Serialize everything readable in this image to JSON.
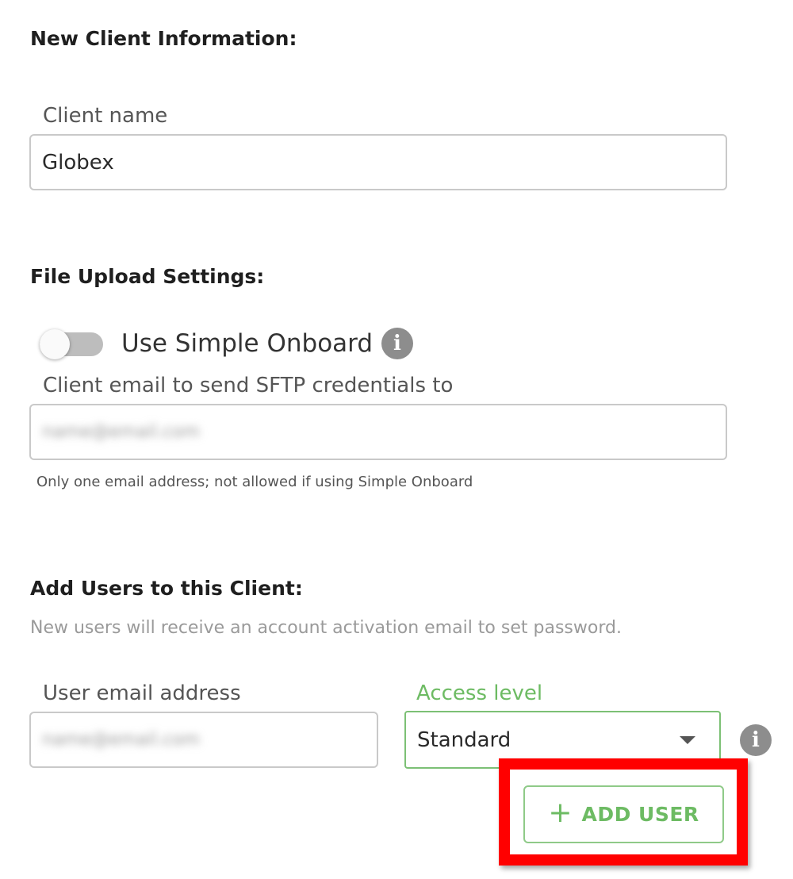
{
  "client_info": {
    "heading": "New Client Information:",
    "client_name_label": "Client name",
    "client_name_value": "Globex"
  },
  "file_upload": {
    "heading": "File Upload Settings:",
    "simple_onboard_label": "Use Simple Onboard",
    "simple_onboard_enabled": false,
    "info_icon": "info-icon",
    "sftp_email_label": "Client email to send SFTP credentials to",
    "sftp_email_value": "name@email.com",
    "sftp_email_helper": "Only one email address; not allowed if using Simple Onboard"
  },
  "add_users": {
    "heading": "Add Users to this Client:",
    "description": "New users will receive an account activation email to set password.",
    "user_email_label": "User email address",
    "user_email_value": "name@email.com",
    "access_level_label": "Access level",
    "access_level_value": "Standard",
    "add_user_plus": "+",
    "add_user_label": "ADD USER"
  },
  "colors": {
    "accent_green": "#6dbb63",
    "highlight_red": "#ff0000",
    "info_icon_gray": "#8d8d8d"
  }
}
